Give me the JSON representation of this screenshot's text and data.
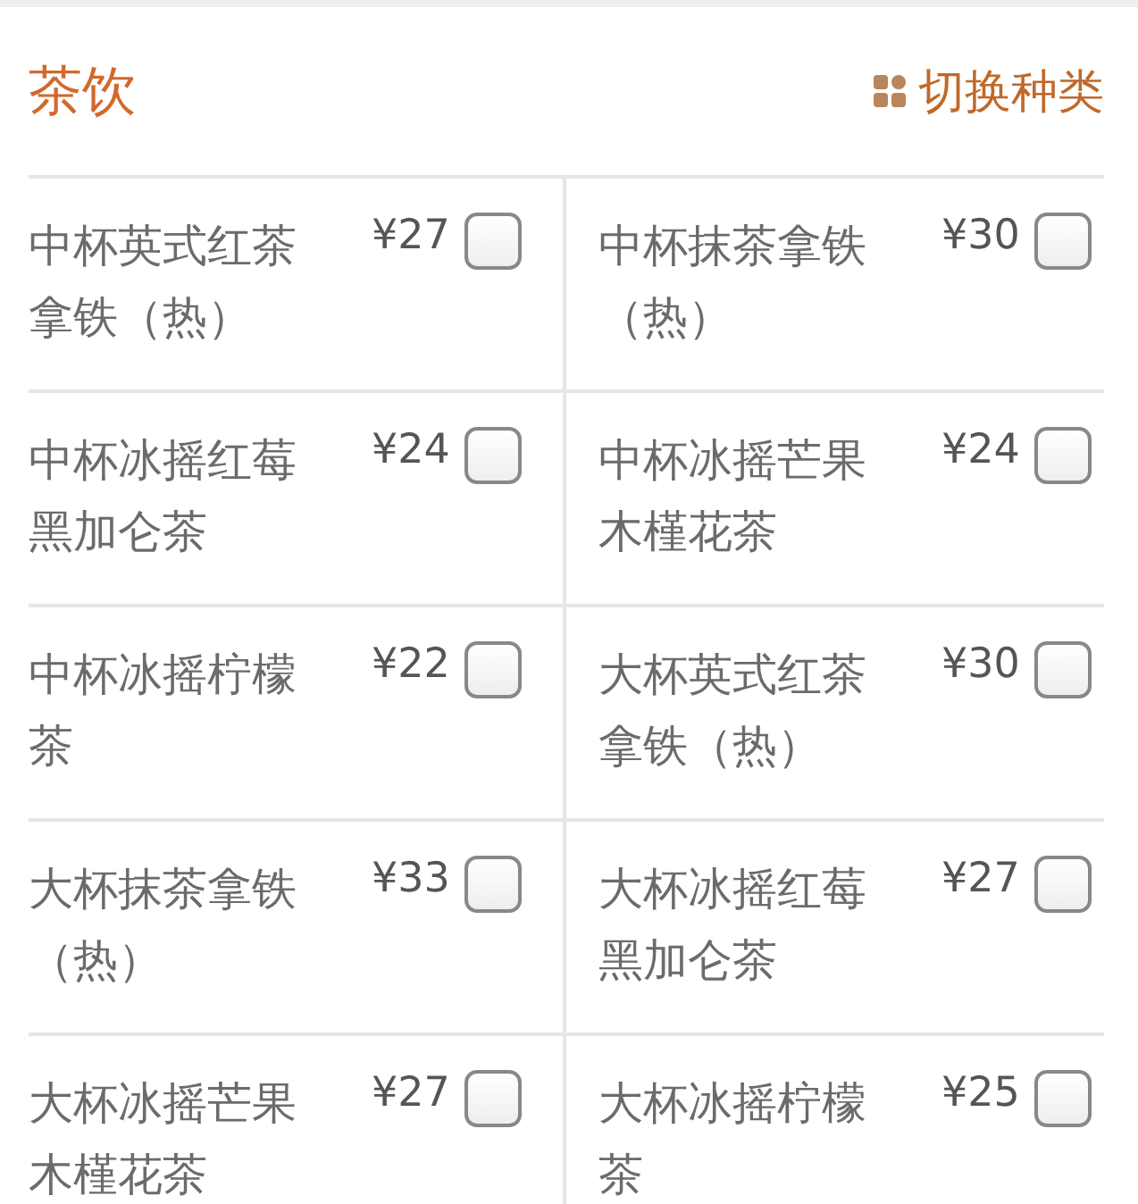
{
  "section": {
    "title": "茶饮",
    "switch_label": "切换种类"
  },
  "items": [
    {
      "name": "中杯英式红茶拿铁（热）",
      "price": "¥27",
      "checked": false
    },
    {
      "name": "中杯抹茶拿铁（热）",
      "price": "¥30",
      "checked": false
    },
    {
      "name": "中杯冰摇红莓黑加仑茶",
      "price": "¥24",
      "checked": false
    },
    {
      "name": "中杯冰摇芒果木槿花茶",
      "price": "¥24",
      "checked": false
    },
    {
      "name": "中杯冰摇柠檬茶",
      "price": "¥22",
      "checked": false
    },
    {
      "name": "大杯英式红茶拿铁（热）",
      "price": "¥30",
      "checked": false
    },
    {
      "name": "大杯抹茶拿铁（热）",
      "price": "¥33",
      "checked": false
    },
    {
      "name": "大杯冰摇红莓黑加仑茶",
      "price": "¥27",
      "checked": false
    },
    {
      "name": "大杯冰摇芒果木槿花茶",
      "price": "¥27",
      "checked": false
    },
    {
      "name": "大杯冰摇柠檬茶",
      "price": "¥25",
      "checked": false
    }
  ]
}
